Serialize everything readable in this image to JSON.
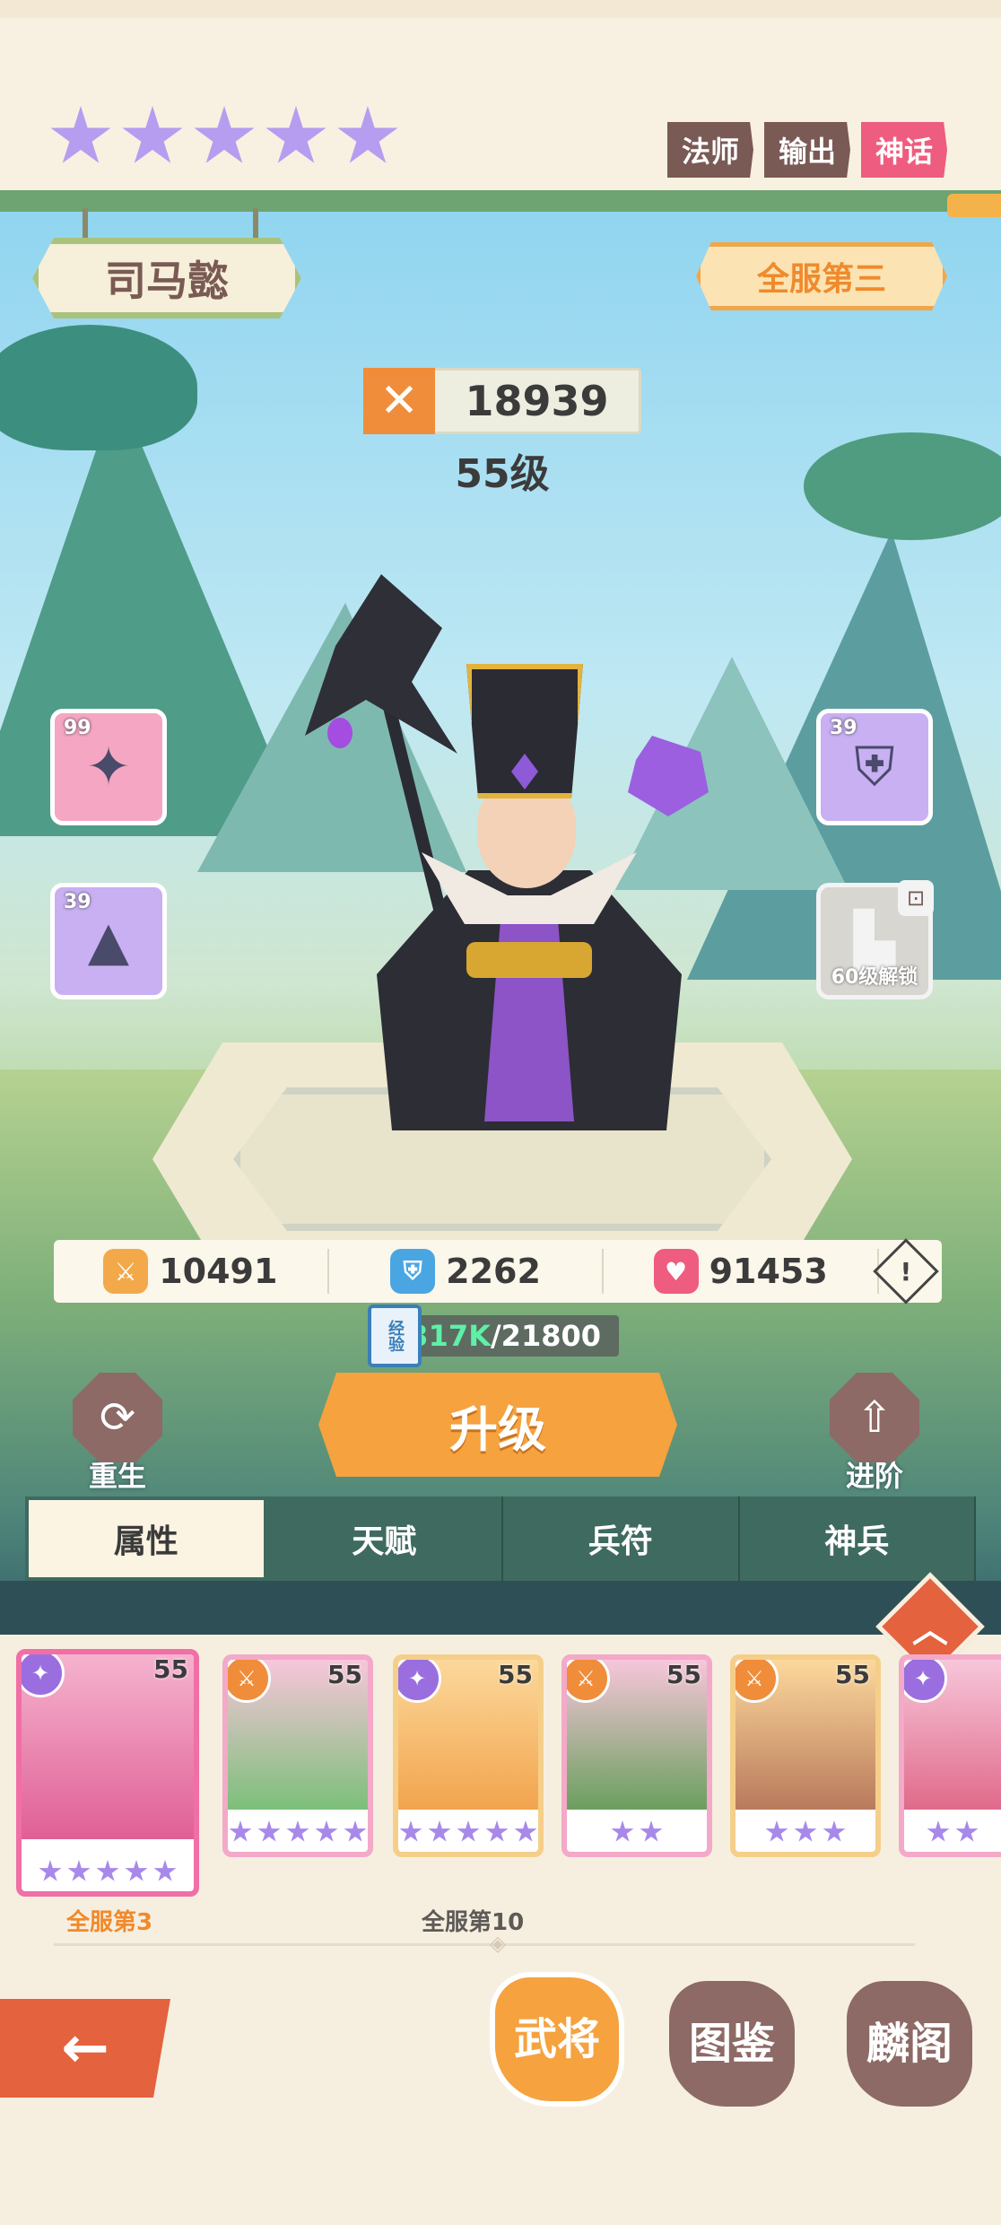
{
  "hero": {
    "name": "司马懿",
    "stars": 5,
    "tags": [
      {
        "label": "法师",
        "variant": "normal"
      },
      {
        "label": "输出",
        "variant": "normal"
      },
      {
        "label": "神话",
        "variant": "myth"
      }
    ],
    "rank": "全服第三",
    "power": "18939",
    "level": "55级"
  },
  "equipment": {
    "weapon": {
      "level": "99",
      "icon": "fan-icon"
    },
    "hat": {
      "level": "39",
      "icon": "hat-icon"
    },
    "armor": {
      "level": "39",
      "icon": "armor-icon"
    },
    "boots": {
      "unlock_text": "60级解锁",
      "icon": "boot-icon",
      "locked": true
    }
  },
  "stats": {
    "attack": "10491",
    "defense": "2262",
    "hp": "91453"
  },
  "exp": {
    "book_label": "经验",
    "current": "317K",
    "required": "/21800"
  },
  "actions": {
    "rebirth": "重生",
    "upgrade": "升级",
    "advance": "进阶"
  },
  "tabs": [
    "属性",
    "天赋",
    "兵符",
    "神兵"
  ],
  "colors": {
    "accent_orange": "#f5a23f",
    "myth_pink": "#ee5c7f",
    "exp_green": "#5ef0a6",
    "tab_green": "#3f6a5f",
    "brown": "#8d6a66"
  },
  "hero_list": [
    {
      "level": "55",
      "class": "mage",
      "stars": 5,
      "frame": "pink",
      "selected": true,
      "label": "全服第3"
    },
    {
      "level": "55",
      "class": "warrior",
      "stars": 5,
      "frame": "pink",
      "selected": false,
      "label": ""
    },
    {
      "level": "55",
      "class": "mage",
      "stars": 5,
      "frame": "gold",
      "selected": false,
      "label": "全服第10"
    },
    {
      "level": "55",
      "class": "warrior",
      "stars": 2,
      "frame": "pink",
      "selected": false,
      "label": ""
    },
    {
      "level": "55",
      "class": "warrior",
      "stars": 3,
      "frame": "gold",
      "selected": false,
      "label": ""
    },
    {
      "level": "",
      "class": "mage",
      "stars": 2,
      "frame": "pink",
      "selected": false,
      "label": ""
    }
  ],
  "bottom_nav": [
    {
      "label": "武将",
      "active": true
    },
    {
      "label": "图鉴",
      "active": false
    },
    {
      "label": "麟阁",
      "active": false
    }
  ]
}
